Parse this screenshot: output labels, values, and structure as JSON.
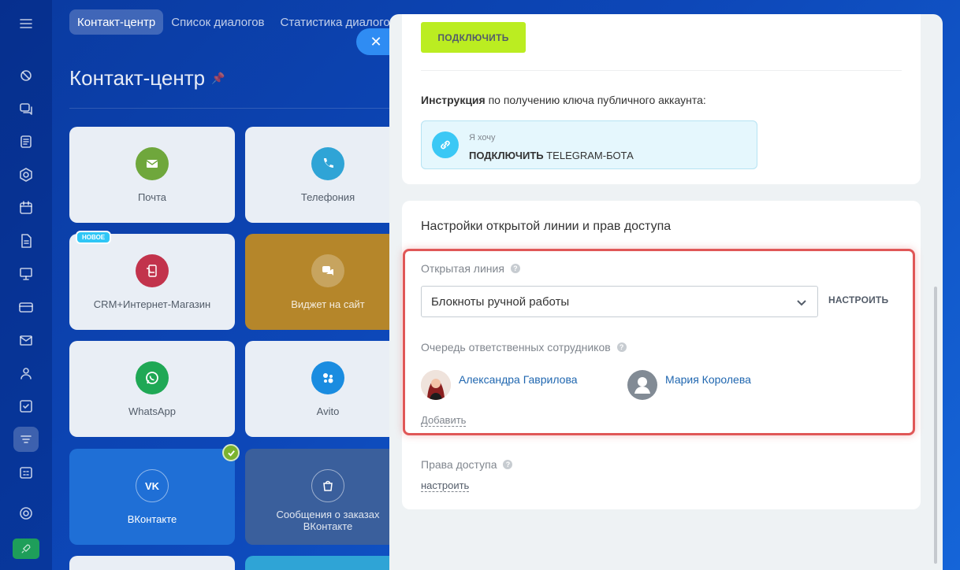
{
  "topnav": {
    "tabs": [
      "Контакт-центр",
      "Список диалогов",
      "Статистика диалогов"
    ]
  },
  "page": {
    "title": "Контакт-центр"
  },
  "tiles": [
    {
      "label": "Почта",
      "color": "#6fa73c",
      "icon": "mail-icon"
    },
    {
      "label": "Телефония",
      "color": "#2fa4d6",
      "icon": "phone-icon"
    },
    {
      "label": "CRM+Интернет-Магазин",
      "color": "#c2334c",
      "icon": "shop-icon",
      "badge": "НОВОЕ"
    },
    {
      "label": "Виджет на сайт",
      "color": "#b5862a",
      "icon": "chat-icon"
    },
    {
      "label": "WhatsApp",
      "color": "#1fa855",
      "icon": "whatsapp-icon"
    },
    {
      "label": "Avito",
      "color": "#1a8ce0",
      "icon": "avito-icon"
    },
    {
      "label": "ВКонтакте",
      "color": "#1f6fd6",
      "icon": "vk-icon"
    },
    {
      "label": "Сообщения о заказах ВКонтакте",
      "color": "#6c7886",
      "icon": "vk-shop-icon"
    }
  ],
  "panel": {
    "connect_button": "ПОДКЛЮЧИТЬ",
    "instruction_bold": "Инструкция",
    "instruction_rest": " по получению ключа публичного аккаунта:",
    "hint_small": "Я хочу",
    "hint_bold": "ПОДКЛЮЧИТЬ",
    "hint_rest": " TELEGRAM-БОТА",
    "settings_title": "Настройки открытой линии и прав доступа",
    "open_line_label": "Открытая линия",
    "open_line_value": "Блокноты ручной работы",
    "configure_button": "НАСТРОИТЬ",
    "queue_label": "Очередь ответственных сотрудников",
    "users": [
      "Александра Гаврилова",
      "Мария Королева"
    ],
    "add_link": "Добавить",
    "access_label": "Права доступа",
    "access_link": "настроить"
  },
  "colors": {
    "accent_green": "#bbed21",
    "highlight": "#e05757",
    "link": "#2067b0"
  }
}
